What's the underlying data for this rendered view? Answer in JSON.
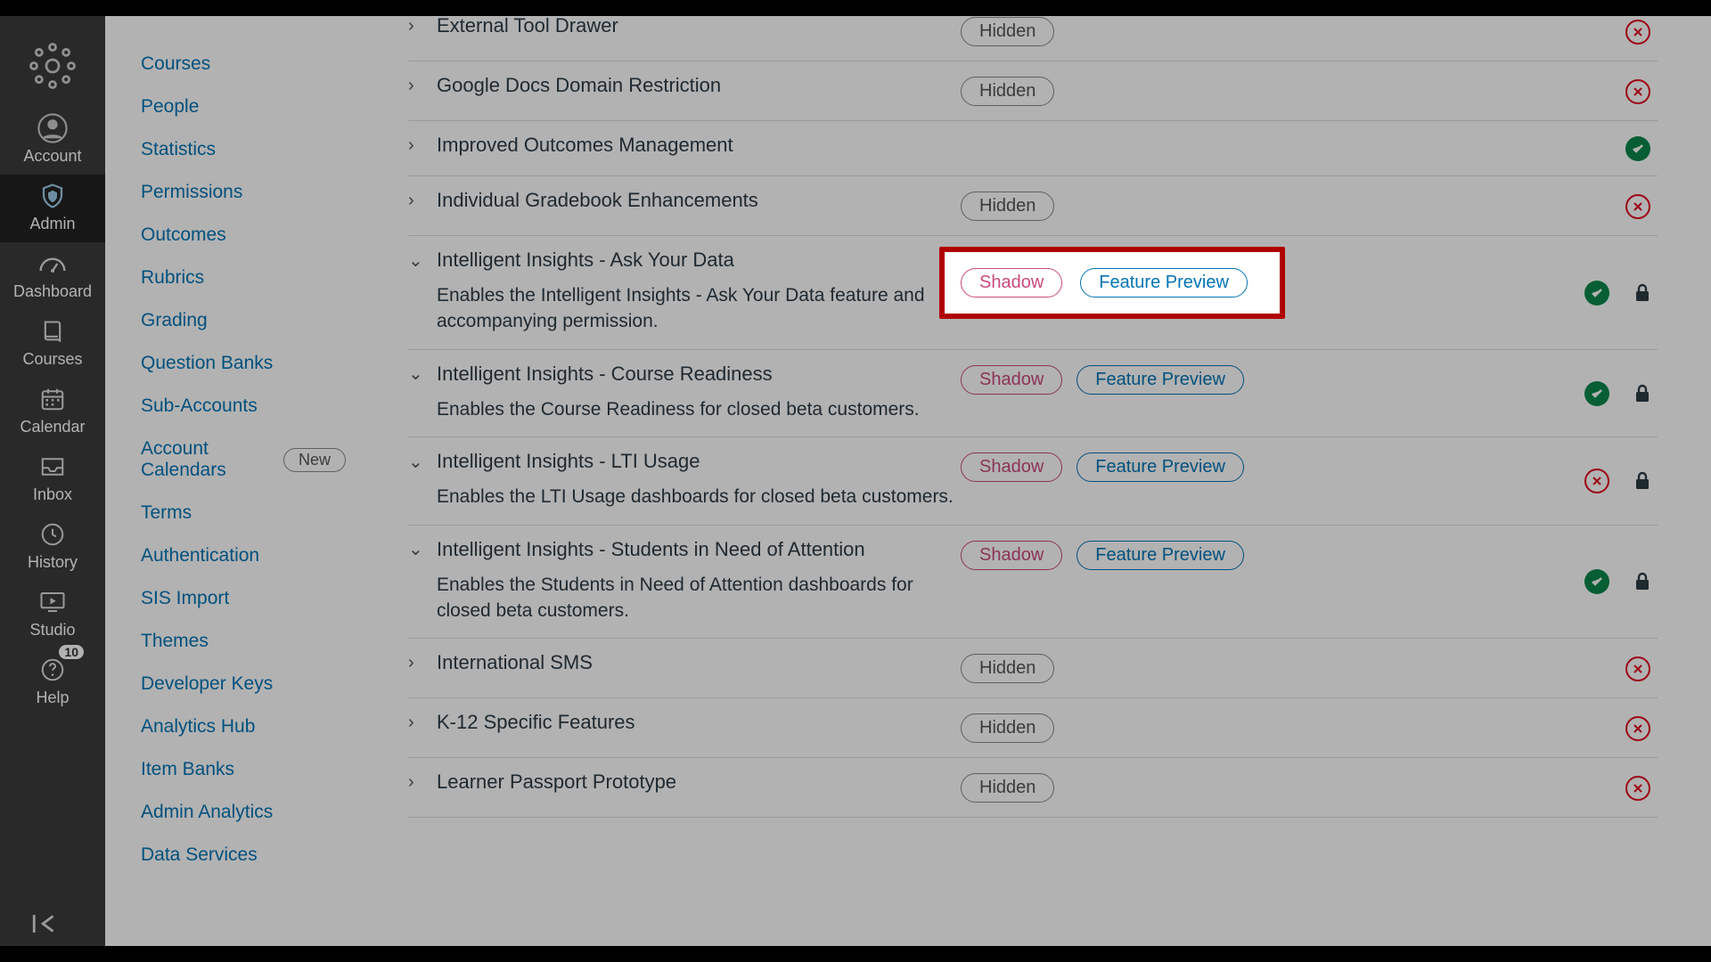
{
  "globalNav": {
    "items": [
      {
        "label": "Account"
      },
      {
        "label": "Admin"
      },
      {
        "label": "Dashboard"
      },
      {
        "label": "Courses"
      },
      {
        "label": "Calendar"
      },
      {
        "label": "Inbox"
      },
      {
        "label": "History"
      },
      {
        "label": "Studio"
      },
      {
        "label": "Help",
        "badge": "10"
      }
    ]
  },
  "sidebar": {
    "links": [
      "Courses",
      "People",
      "Statistics",
      "Permissions",
      "Outcomes",
      "Rubrics",
      "Grading",
      "Question Banks",
      "Sub-Accounts"
    ],
    "accountCalendars": {
      "label": "Account Calendars",
      "badge": "New"
    },
    "linksAfter": [
      "Terms",
      "Authentication",
      "SIS Import",
      "Themes",
      "Developer Keys",
      "Analytics Hub",
      "Item Banks",
      "Admin Analytics",
      "Data Services"
    ]
  },
  "pills": {
    "hidden": "Hidden",
    "shadow": "Shadow",
    "preview": "Feature Preview"
  },
  "features": [
    {
      "title": "External Tool Drawer",
      "expanded": false,
      "desc": "",
      "tags": [
        "hidden"
      ],
      "status": "x",
      "locked": false
    },
    {
      "title": "Google Docs Domain Restriction",
      "expanded": false,
      "desc": "",
      "tags": [
        "hidden"
      ],
      "status": "x",
      "locked": false
    },
    {
      "title": "Improved Outcomes Management",
      "expanded": false,
      "desc": "",
      "tags": [],
      "status": "ok",
      "locked": false
    },
    {
      "title": "Individual Gradebook Enhancements",
      "expanded": false,
      "desc": "",
      "tags": [
        "hidden"
      ],
      "status": "x",
      "locked": false
    },
    {
      "title": "Intelligent Insights - Ask Your Data",
      "expanded": true,
      "desc": "Enables the Intelligent Insights - Ask Your Data feature and accompanying permission.",
      "tags": [
        "shadow",
        "preview"
      ],
      "status": "ok",
      "locked": true,
      "highlight": true
    },
    {
      "title": "Intelligent Insights - Course Readiness",
      "expanded": true,
      "desc": "Enables the Course Readiness for closed beta customers.",
      "tags": [
        "shadow",
        "preview"
      ],
      "status": "ok",
      "locked": true
    },
    {
      "title": "Intelligent Insights - LTI Usage",
      "expanded": true,
      "desc": "Enables the LTI Usage dashboards for closed beta customers.",
      "tags": [
        "shadow",
        "preview"
      ],
      "status": "x",
      "locked": true
    },
    {
      "title": "Intelligent Insights - Students in Need of Attention",
      "expanded": true,
      "desc": "Enables the Students in Need of Attention dashboards for closed beta customers.",
      "tags": [
        "shadow",
        "preview"
      ],
      "status": "ok",
      "locked": true
    },
    {
      "title": "International SMS",
      "expanded": false,
      "desc": "",
      "tags": [
        "hidden"
      ],
      "status": "x",
      "locked": false
    },
    {
      "title": "K-12 Specific Features",
      "expanded": false,
      "desc": "",
      "tags": [
        "hidden"
      ],
      "status": "x",
      "locked": false
    },
    {
      "title": "Learner Passport Prototype",
      "expanded": false,
      "desc": "",
      "tags": [
        "hidden"
      ],
      "status": "x",
      "locked": false
    }
  ]
}
